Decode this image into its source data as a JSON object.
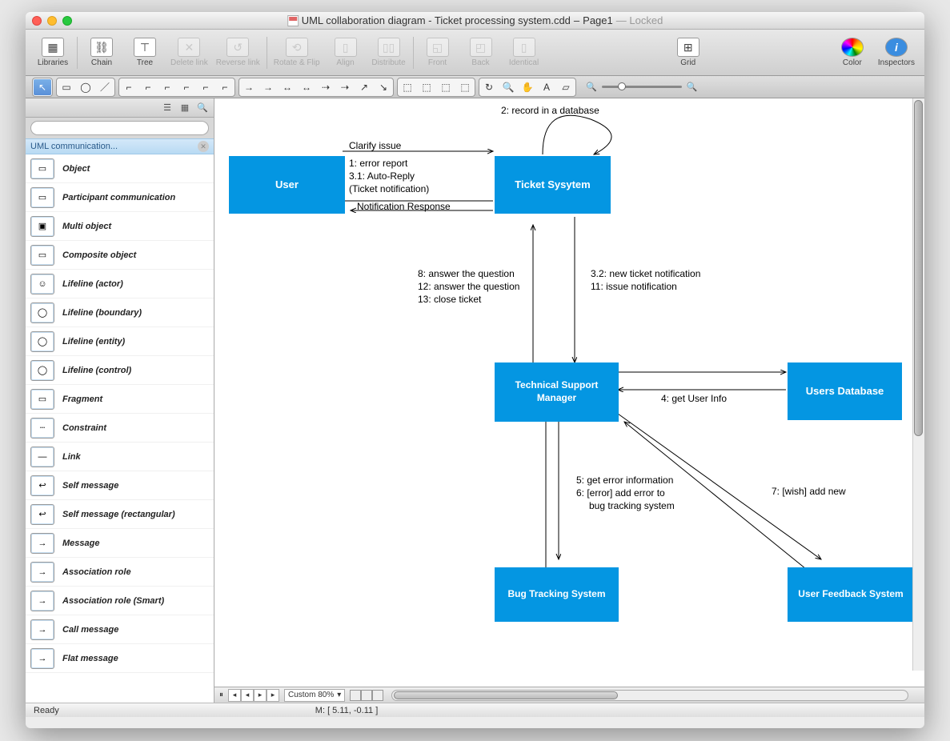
{
  "title": {
    "doc": "UML collaboration diagram - Ticket processing system.cdd",
    "page": "Page1",
    "locked": "Locked"
  },
  "toolbar": {
    "libraries": "Libraries",
    "chain": "Chain",
    "tree": "Tree",
    "delete_link": "Delete link",
    "reverse_link": "Reverse link",
    "rotate_flip": "Rotate & Flip",
    "align": "Align",
    "distribute": "Distribute",
    "front": "Front",
    "back": "Back",
    "identical": "Identical",
    "grid": "Grid",
    "color": "Color",
    "inspectors": "Inspectors"
  },
  "sidebar": {
    "lib_title": "UML communication...",
    "items": [
      "Object",
      "Participant communication",
      "Multi object",
      "Composite object",
      "Lifeline (actor)",
      "Lifeline (boundary)",
      "Lifeline (entity)",
      "Lifeline (control)",
      "Fragment",
      "Constraint",
      "Link",
      "Self message",
      "Self message (rectangular)",
      "Message",
      "Association role",
      "Association role (Smart)",
      "Call message",
      "Flat message"
    ]
  },
  "diagram": {
    "nodes": {
      "user": "User",
      "ticket": "Ticket Sysytem",
      "tsm": "Technical Support Manager",
      "usersdb": "Users Database",
      "bug": "Bug Tracking System",
      "feedback": "User Feedback System"
    },
    "labels": {
      "clarify": "Clarify issue",
      "msg1": "1: error report",
      "msg31": "3.1: Auto-Reply",
      "ticket_notif": "(Ticket notification)",
      "notif_resp": "Notification Response",
      "record": "2: record in a database",
      "l8": "8: answer the question",
      "l12": "12: answer the question",
      "l13": "13: close ticket",
      "l32": "3.2: new ticket notification",
      "l11": "11: issue notification",
      "l4": "4: get User Info",
      "l5": "5: get error information",
      "l6a": "6: [error] add error to",
      "l6b": "bug tracking system",
      "l7": "7: [wish] add new"
    }
  },
  "bottombar": {
    "zoom": "Custom 80%"
  },
  "status": {
    "ready": "Ready",
    "coord": "M: [ 5.11, -0.11 ]"
  }
}
